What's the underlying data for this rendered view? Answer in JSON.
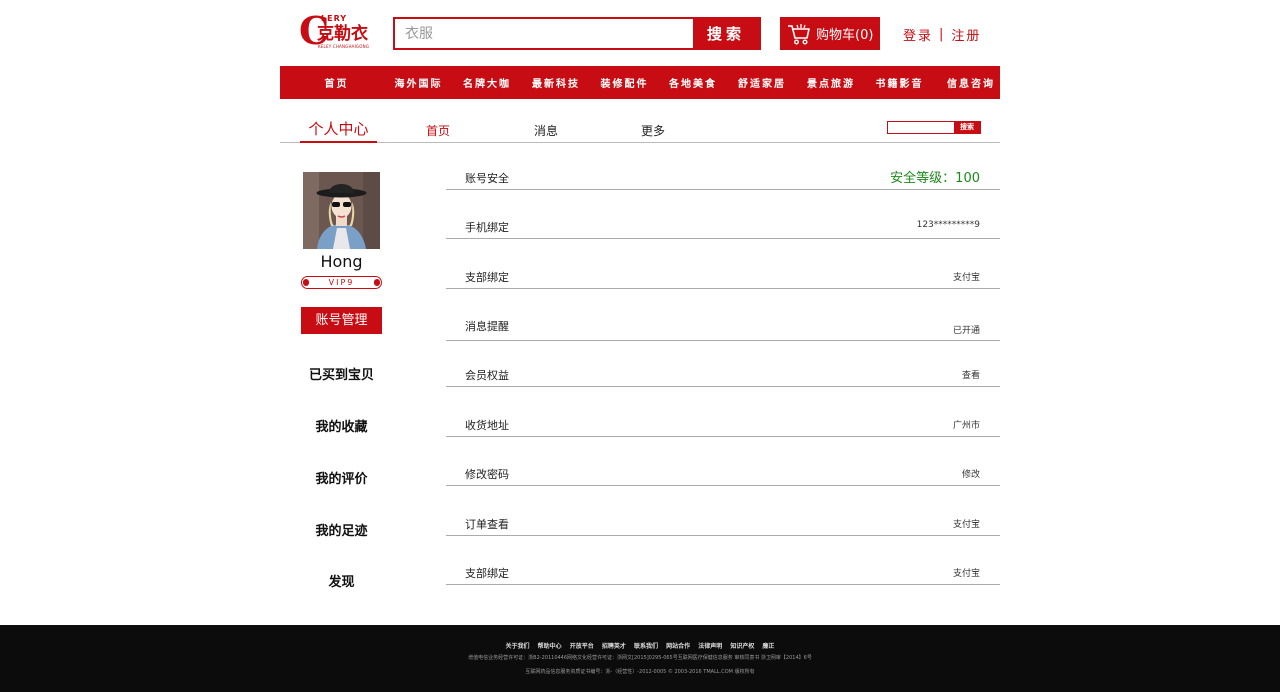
{
  "header": {
    "logo": {
      "initial": "C",
      "brand_en": "LERY",
      "brand_cn": "克勒衣",
      "brand_sub": "KELEY CHANGHAIGONG"
    },
    "search": {
      "placeholder": "衣服",
      "button": "搜索"
    },
    "cart": {
      "label": "购物车(0)",
      "icon": "shopping-cart-icon"
    },
    "auth": {
      "login": "登录",
      "separator": "|",
      "register": "注册"
    }
  },
  "main_nav": {
    "items": [
      "首页",
      "海外国际",
      "名牌大咖",
      "最新科技",
      "装修配件",
      "各地美食",
      "舒适家居",
      "景点旅游",
      "书籍影音",
      "信息咨询"
    ]
  },
  "sub_nav": {
    "title": "个人中心",
    "links": [
      "首页",
      "消息",
      "更多"
    ],
    "mini_search_button": "搜索"
  },
  "sidebar": {
    "username": "Hong",
    "vip": "VIP9",
    "active_item": "账号管理",
    "items": [
      "已买到宝贝",
      "我的收藏",
      "我的评价",
      "我的足迹",
      "发现"
    ]
  },
  "info_rows": [
    {
      "label": "账号安全",
      "value": "安全等级：100"
    },
    {
      "label": "手机绑定",
      "value": "123*********9"
    },
    {
      "label": "支部绑定",
      "value": "支付宝"
    },
    {
      "label": "消息提醒",
      "value": "已开通"
    },
    {
      "label": "会员权益",
      "value": "查看"
    },
    {
      "label": "收货地址",
      "value": "广州市"
    },
    {
      "label": "修改密码",
      "value": "修改"
    },
    {
      "label": "订单查看",
      "value": "支付宝"
    },
    {
      "label": "支部绑定",
      "value": "支付宝"
    }
  ],
  "footer": {
    "links": [
      "关于我们",
      "帮助中心",
      "开放平台",
      "招聘英才",
      "联系我们",
      "网站合作",
      "法律声明",
      "知识产权",
      "廉正"
    ],
    "line1": "增值电信业务经营许可证：浙B2-20110446网络文化经营许可证：浙网文[2015]0295-065号互联网医疗保健信息服务 审核同意书 浙卫网审【2014】6号",
    "line2": "互联网药品信息服务资质证书编号：浙-（经营性）-2012-0005        © 2003-2016 TMALL.COM 版权所有"
  },
  "colors": {
    "brand_red": "#c70d13",
    "security_green": "#1b8a1b",
    "footer_bg": "#0c0c0c"
  }
}
